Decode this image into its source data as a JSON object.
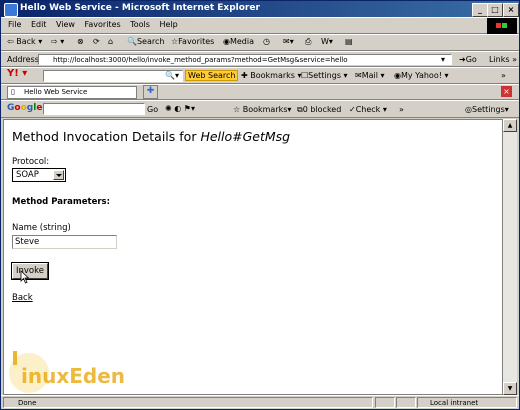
{
  "window": {
    "title": "Hello Web Service - Microsoft Internet Explorer"
  },
  "menu": [
    "File",
    "Edit",
    "View",
    "Favorites",
    "Tools",
    "Help"
  ],
  "toolbar": {
    "back": "Back",
    "search": "Search",
    "favorites": "Favorites",
    "media": "Media"
  },
  "address": {
    "label": "Address",
    "url": "http://localhost:3000/hello/invoke_method_params?method=GetMsg&service=hello",
    "go": "Go",
    "links": "Links"
  },
  "yahoo_bar": {
    "web_search": "Web Search",
    "bookmarks": "Bookmarks",
    "settings": "Settings",
    "mail": "Mail",
    "my_yahoo": "My Yahoo!"
  },
  "tab": {
    "title": "Hello Web Service"
  },
  "google_bar": {
    "go": "Go",
    "bookmarks": "Bookmarks",
    "blocked": "0 blocked",
    "check": "Check",
    "settings": "Settings"
  },
  "page": {
    "heading_prefix": "Method Invocation Details for ",
    "heading_method": "Hello#GetMsg",
    "protocol_label": "Protocol:",
    "protocol_value": "SOAP",
    "params_heading": "Method Parameters:",
    "param_label": "Name (string)",
    "param_value": "Steve",
    "invoke_label": "Invoke",
    "back_link": "Back"
  },
  "status": {
    "text": "Done",
    "zone": "Local intranet"
  },
  "watermark": {
    "text": "inuxEden"
  }
}
